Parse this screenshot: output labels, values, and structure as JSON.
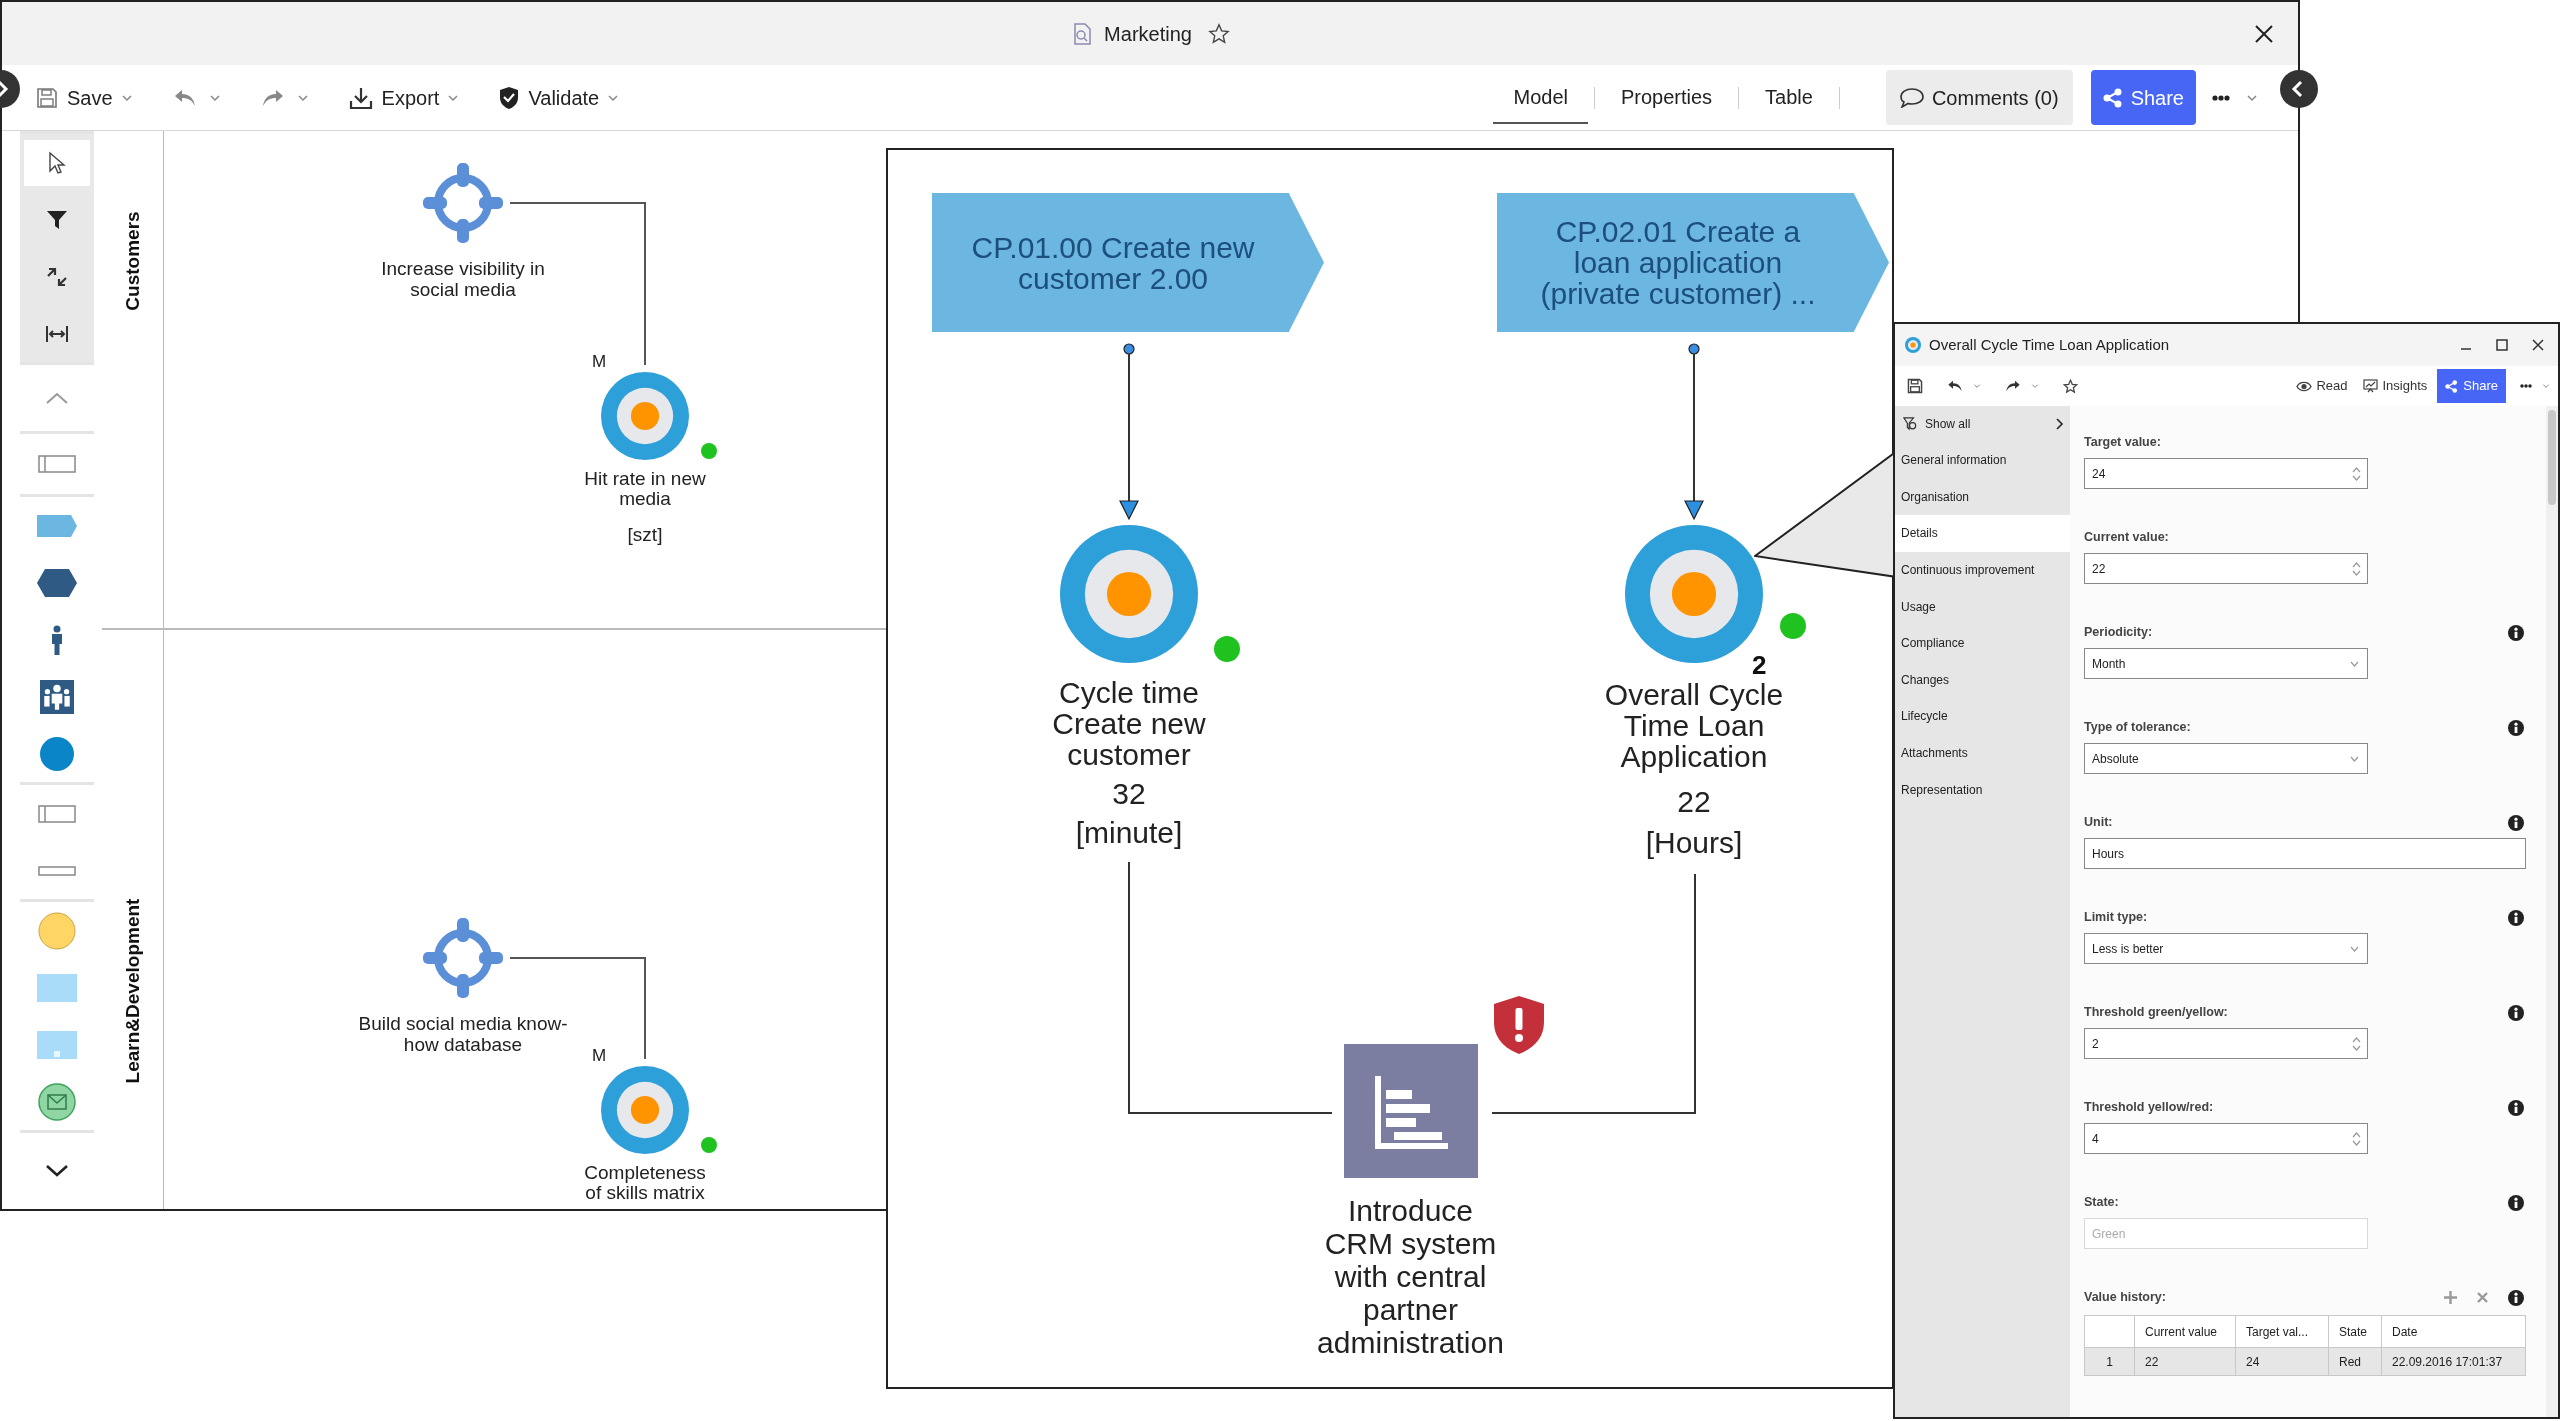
{
  "window": {
    "title": "Marketing"
  },
  "toolbar": {
    "save": "Save",
    "export": "Export",
    "validate": "Validate"
  },
  "tabs": [
    {
      "label": "Model",
      "selected": true
    },
    {
      "label": "Properties",
      "selected": false
    },
    {
      "label": "Table",
      "selected": false
    }
  ],
  "comments": "Comments (0)",
  "share": "Share",
  "lanes": [
    {
      "label": "Customers",
      "goal": "Increase visibility in social media",
      "kpi": {
        "marker": "M",
        "name": "Hit rate in new media",
        "unit": "[szt]",
        "color": "#1fc21f"
      }
    },
    {
      "label": "Learn&Development",
      "goal": "Build social media know-how database",
      "kpi": {
        "marker": "M",
        "name": "Completeness of skills matrix",
        "color": "#1fc21f"
      }
    }
  ],
  "detail": {
    "processes": [
      {
        "label": "CP.01.00 Create new customer 2.00"
      },
      {
        "label": "CP.02.01 Create a loan application (private customer) ..."
      }
    ],
    "kpis": [
      {
        "name": "Cycle time Create new customer",
        "value": "32",
        "unit": "[minute]",
        "color": "#1fc21f"
      },
      {
        "name": "Overall Cycle Time Loan Application",
        "badge": "2",
        "value": "22",
        "unit": "[Hours]",
        "color": "#1fc21f"
      }
    ],
    "measure": {
      "label": "Introduce CRM system with central partner administration",
      "warning": true
    }
  },
  "dialog": {
    "title": "Overall Cycle Time Loan Application",
    "read": "Read",
    "insights": "Insights",
    "share": "Share",
    "filter": "Show all",
    "nav": [
      {
        "label": "General information",
        "selected": false
      },
      {
        "label": "Organisation",
        "selected": false
      },
      {
        "label": "Details",
        "selected": true
      },
      {
        "label": "Continuous improvement",
        "selected": false
      },
      {
        "label": "Usage",
        "selected": false
      },
      {
        "label": "Compliance",
        "selected": false
      },
      {
        "label": "Changes",
        "selected": false
      },
      {
        "label": "Lifecycle",
        "selected": false
      },
      {
        "label": "Attachments",
        "selected": false
      },
      {
        "label": "Representation",
        "selected": false
      }
    ],
    "fields": [
      {
        "label": "Target value:",
        "kind": "spin",
        "value": "24",
        "info": false
      },
      {
        "label": "Current value:",
        "kind": "spin",
        "value": "22",
        "info": false
      },
      {
        "label": "Periodicity:",
        "kind": "select",
        "value": "Month",
        "info": true
      },
      {
        "label": "Type of tolerance:",
        "kind": "select",
        "value": "Absolute",
        "info": true
      },
      {
        "label": "Unit:",
        "kind": "text",
        "value": "Hours",
        "info": true
      },
      {
        "label": "Limit type:",
        "kind": "select",
        "value": "Less is better",
        "info": true
      },
      {
        "label": "Threshold green/yellow:",
        "kind": "spin",
        "value": "2",
        "info": true
      },
      {
        "label": "Threshold yellow/red:",
        "kind": "spin",
        "value": "4",
        "info": true
      },
      {
        "label": "State:",
        "kind": "readonly",
        "value": "Green",
        "info": true
      }
    ],
    "value_history": {
      "label": "Value history:",
      "info": true,
      "columns": [
        "Current value",
        "Target val...",
        "State",
        "Date"
      ],
      "rows": [
        {
          "index": "1",
          "selected": true,
          "cells": [
            "22",
            "24",
            "Red",
            "22.09.2016 17:01:37"
          ]
        }
      ]
    }
  }
}
